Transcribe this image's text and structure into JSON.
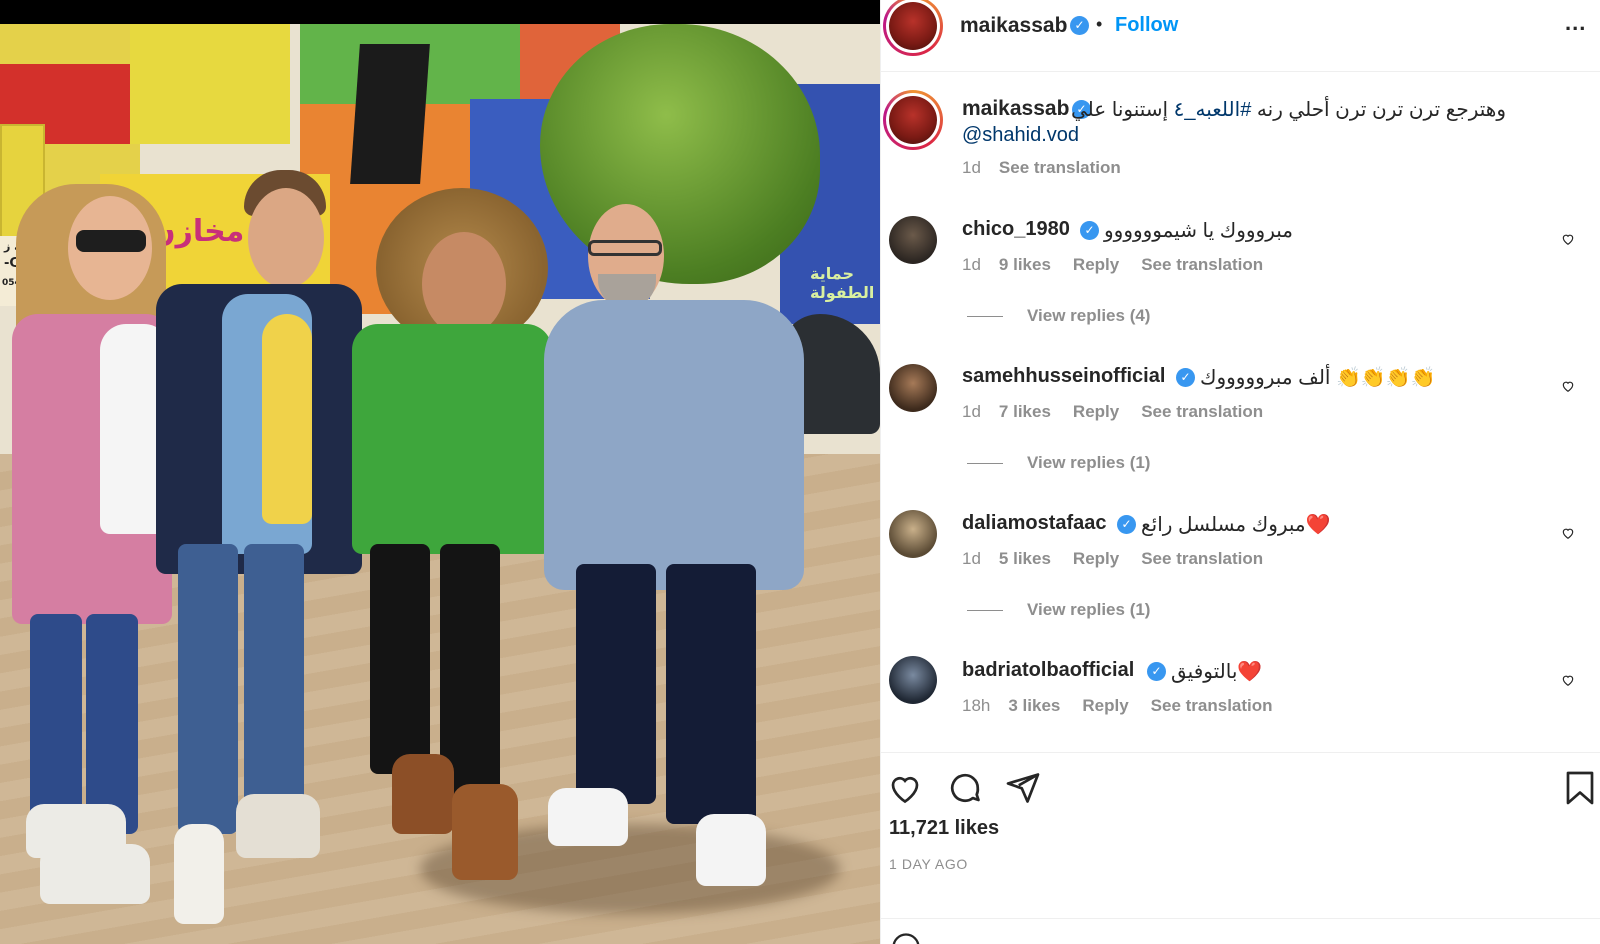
{
  "post": {
    "username": "maikassab",
    "follow_label": "Follow",
    "separator": "•",
    "more_label": "...",
    "caption": {
      "text_before": "وهترجع ترن ترن ترن أحلي رنه ",
      "hashtag": "#اللعبه_٤",
      "text_after": " إستنونا علي",
      "mention": "@shahid.vod",
      "time": "1d",
      "see_translation": "See translation"
    },
    "photo_signs": {
      "shop_left": "مدرسة ز",
      "car_text": "-CAR",
      "phone": "0548532-0100",
      "yellow_sign": "مخازن",
      "blue_sign": "حماية الطفولة"
    }
  },
  "comments": [
    {
      "username": "chico_1980",
      "text": "مبروووك يا شيموووووو",
      "time": "1d",
      "likes": "9 likes",
      "reply": "Reply",
      "see_translation": "See translation",
      "view_replies": "View replies (4)"
    },
    {
      "username": "samehhusseinofficial",
      "text": "ألف مبروووووك 👏👏👏👏",
      "time": "1d",
      "likes": "7 likes",
      "reply": "Reply",
      "see_translation": "See translation",
      "view_replies": "View replies (1)"
    },
    {
      "username": "daliamostafaac",
      "text": "مبروك مسلسل رائع❤️",
      "time": "1d",
      "likes": "5 likes",
      "reply": "Reply",
      "see_translation": "See translation",
      "view_replies": "View replies (1)"
    },
    {
      "username": "badriatolbaofficial",
      "text": "بالتوفيق❤️",
      "time": "18h",
      "likes": "3 likes",
      "reply": "Reply",
      "see_translation": "See translation"
    }
  ],
  "footer": {
    "likes": "11,721 likes",
    "ago": "1 DAY AGO"
  },
  "colors": {
    "link_blue": "#0095f6",
    "hashtag_blue": "#00376b",
    "muted": "#8e8e8e",
    "verified": "#3897f0"
  }
}
